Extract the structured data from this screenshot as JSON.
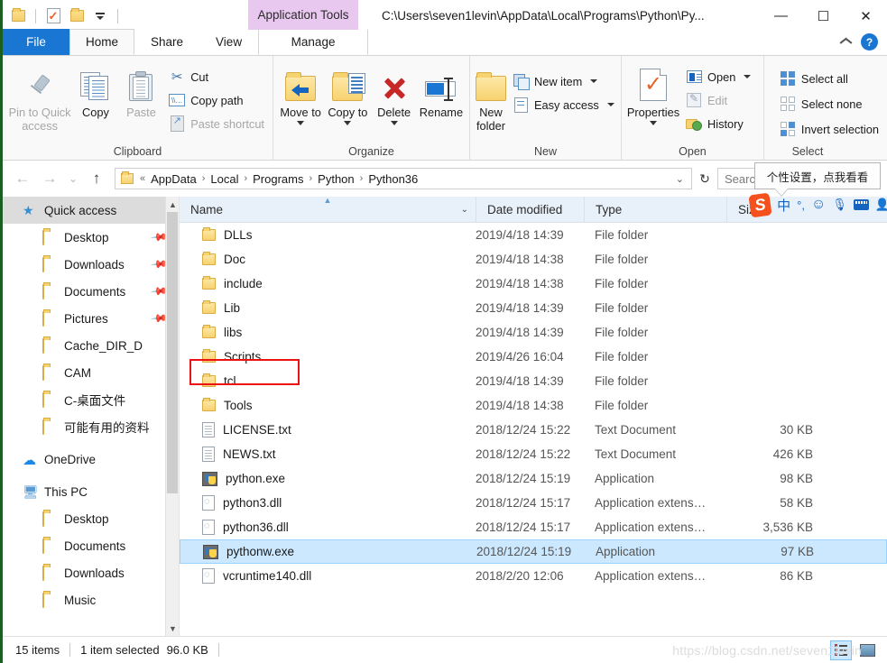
{
  "window": {
    "title_path": "C:\\Users\\seven1levin\\AppData\\Local\\Programs\\Python\\Py...",
    "contextual_tab_label": "Application Tools",
    "minimize": "—",
    "maximize": "☐",
    "close": "✕"
  },
  "quick_access_toolbar": {
    "folder_label": "",
    "properties_label": "",
    "new_folder_label": "",
    "customize_label": ""
  },
  "tabs": [
    {
      "label": "File",
      "id": "file"
    },
    {
      "label": "Home",
      "id": "home"
    },
    {
      "label": "Share",
      "id": "share"
    },
    {
      "label": "View",
      "id": "view"
    },
    {
      "label": "Manage",
      "id": "manage"
    }
  ],
  "tabrow_right": {
    "collapse_label": "",
    "help_label": "?"
  },
  "ribbon": {
    "groups": [
      {
        "name": "Clipboard",
        "label": "Clipboard",
        "big_buttons": [
          {
            "label": "Pin to Quick access",
            "id": "pin-to-quick-access",
            "disabled": false
          },
          {
            "label": "Copy",
            "id": "copy",
            "disabled": false
          },
          {
            "label": "Paste",
            "id": "paste",
            "disabled": true
          }
        ],
        "small_buttons": [
          {
            "label": "Cut",
            "id": "cut",
            "disabled": false
          },
          {
            "label": "Copy path",
            "id": "copy-path",
            "disabled": false
          },
          {
            "label": "Paste shortcut",
            "id": "paste-shortcut",
            "disabled": true
          }
        ]
      },
      {
        "name": "Organize",
        "label": "Organize",
        "big_buttons": [
          {
            "label": "Move to",
            "id": "move-to",
            "has_caret": true
          },
          {
            "label": "Copy to",
            "id": "copy-to",
            "has_caret": true
          },
          {
            "label": "Delete",
            "id": "delete",
            "has_caret": true
          },
          {
            "label": "Rename",
            "id": "rename",
            "has_caret": false
          }
        ]
      },
      {
        "name": "New",
        "label": "New",
        "big_buttons": [
          {
            "label": "New folder",
            "id": "new-folder"
          }
        ],
        "small_buttons": [
          {
            "label": "New item",
            "id": "new-item",
            "has_caret": true
          },
          {
            "label": "Easy access",
            "id": "easy-access",
            "has_caret": true
          }
        ]
      },
      {
        "name": "Open",
        "label": "Open",
        "big_buttons": [
          {
            "label": "Properties",
            "id": "properties",
            "has_caret": true
          }
        ],
        "small_buttons": [
          {
            "label": "Open",
            "id": "open",
            "has_caret": true,
            "disabled": false
          },
          {
            "label": "Edit",
            "id": "edit",
            "disabled": true
          },
          {
            "label": "History",
            "id": "history",
            "disabled": false
          }
        ]
      },
      {
        "name": "Select",
        "label": "Select",
        "small_buttons": [
          {
            "label": "Select all",
            "id": "select-all"
          },
          {
            "label": "Select none",
            "id": "select-none"
          },
          {
            "label": "Invert selection",
            "id": "invert-selection"
          }
        ]
      }
    ]
  },
  "addressbar": {
    "back": "←",
    "forward": "→",
    "recent": "⌄",
    "up": "↑",
    "breadcrumb_prefix": "«",
    "breadcrumbs": [
      "AppData",
      "Local",
      "Programs",
      "Python",
      "Python36"
    ],
    "separator": "›",
    "dropdown": "⌄",
    "refresh": "↻",
    "search_placeholder": "Search Python3"
  },
  "sidebar": {
    "items": [
      {
        "label": "Quick access",
        "icon": "star-icon",
        "level": "root",
        "selected": true,
        "pinned": false
      },
      {
        "label": "Desktop",
        "icon": "folder-desktop-icon",
        "level": "child",
        "selected": false,
        "pinned": true
      },
      {
        "label": "Downloads",
        "icon": "folder-downloads-icon",
        "level": "child",
        "selected": false,
        "pinned": true
      },
      {
        "label": "Documents",
        "icon": "folder-documents-icon",
        "level": "child",
        "selected": false,
        "pinned": true
      },
      {
        "label": "Pictures",
        "icon": "folder-pictures-icon",
        "level": "child",
        "selected": false,
        "pinned": true
      },
      {
        "label": "Cache_DIR_D",
        "icon": "folder-icon",
        "level": "child",
        "selected": false,
        "pinned": false
      },
      {
        "label": "CAM",
        "icon": "folder-icon",
        "level": "child",
        "selected": false,
        "pinned": false
      },
      {
        "label": "C-桌面文件",
        "icon": "folder-icon",
        "level": "child",
        "selected": false,
        "pinned": false
      },
      {
        "label": "可能有用的资料",
        "icon": "folder-icon",
        "level": "child",
        "selected": false,
        "pinned": false
      },
      {
        "label": "OneDrive",
        "icon": "cloud-icon",
        "level": "root",
        "selected": false,
        "pinned": false
      },
      {
        "label": "This PC",
        "icon": "computer-icon",
        "level": "root",
        "selected": false,
        "pinned": false
      },
      {
        "label": "Desktop",
        "icon": "folder-desktop-icon",
        "level": "child",
        "selected": false,
        "pinned": false
      },
      {
        "label": "Documents",
        "icon": "folder-documents-icon",
        "level": "child",
        "selected": false,
        "pinned": false
      },
      {
        "label": "Downloads",
        "icon": "folder-downloads-icon",
        "level": "child",
        "selected": false,
        "pinned": false
      },
      {
        "label": "Music",
        "icon": "folder-music-icon",
        "level": "child",
        "selected": false,
        "pinned": false
      }
    ]
  },
  "filelist": {
    "columns": [
      {
        "label": "Name",
        "id": "name"
      },
      {
        "label": "Date modified",
        "id": "date-modified"
      },
      {
        "label": "Type",
        "id": "type"
      },
      {
        "label": "Size",
        "id": "size"
      }
    ],
    "sorted_column": "Name",
    "rows": [
      {
        "name": "DLLs",
        "date": "2019/4/18 14:39",
        "type": "File folder",
        "size": "",
        "icon": "folder-icon",
        "selected": false
      },
      {
        "name": "Doc",
        "date": "2019/4/18 14:38",
        "type": "File folder",
        "size": "",
        "icon": "folder-icon",
        "selected": false
      },
      {
        "name": "include",
        "date": "2019/4/18 14:38",
        "type": "File folder",
        "size": "",
        "icon": "folder-icon",
        "selected": false
      },
      {
        "name": "Lib",
        "date": "2019/4/18 14:39",
        "type": "File folder",
        "size": "",
        "icon": "folder-icon",
        "selected": false
      },
      {
        "name": "libs",
        "date": "2019/4/18 14:39",
        "type": "File folder",
        "size": "",
        "icon": "folder-icon",
        "selected": false
      },
      {
        "name": "Scripts",
        "date": "2019/4/26 16:04",
        "type": "File folder",
        "size": "",
        "icon": "folder-icon",
        "selected": false,
        "highlighted": true
      },
      {
        "name": "tcl",
        "date": "2019/4/18 14:39",
        "type": "File folder",
        "size": "",
        "icon": "folder-icon",
        "selected": false
      },
      {
        "name": "Tools",
        "date": "2019/4/18 14:38",
        "type": "File folder",
        "size": "",
        "icon": "folder-icon",
        "selected": false
      },
      {
        "name": "LICENSE.txt",
        "date": "2018/12/24 15:22",
        "type": "Text Document",
        "size": "30 KB",
        "icon": "text-file-icon",
        "selected": false
      },
      {
        "name": "NEWS.txt",
        "date": "2018/12/24 15:22",
        "type": "Text Document",
        "size": "426 KB",
        "icon": "text-file-icon",
        "selected": false
      },
      {
        "name": "python.exe",
        "date": "2018/12/24 15:19",
        "type": "Application",
        "size": "98 KB",
        "icon": "python-exe-icon",
        "selected": false
      },
      {
        "name": "python3.dll",
        "date": "2018/12/24 15:17",
        "type": "Application extens…",
        "size": "58 KB",
        "icon": "dll-file-icon",
        "selected": false
      },
      {
        "name": "python36.dll",
        "date": "2018/12/24 15:17",
        "type": "Application extens…",
        "size": "3,536 KB",
        "icon": "dll-file-icon",
        "selected": false
      },
      {
        "name": "pythonw.exe",
        "date": "2018/12/24 15:19",
        "type": "Application",
        "size": "97 KB",
        "icon": "python-exe-icon",
        "selected": true
      },
      {
        "name": "vcruntime140.dll",
        "date": "2018/2/20 12:06",
        "type": "Application extens…",
        "size": "86 KB",
        "icon": "dll-file-icon",
        "selected": false
      }
    ]
  },
  "ime": {
    "tooltip": "个性设置，点我看看",
    "logo": "S",
    "mode": "中",
    "punct": "°,",
    "emoji": "☺",
    "mic": "🎤",
    "keyboard": "",
    "more": ""
  },
  "statusbar": {
    "item_count": "15 items",
    "selection": "1 item selected",
    "selection_size": "96.0 KB",
    "view_details": "",
    "view_thumbnails": ""
  },
  "watermark": "https://blog.csdn.net/seven1levin",
  "colors": {
    "accent": "#1976d2",
    "selection": "#cce8ff",
    "header": "#e8f1fa",
    "contextual_tab": "#e8c8ef",
    "annotation": "#ee1111",
    "folder": "#f7d270"
  }
}
